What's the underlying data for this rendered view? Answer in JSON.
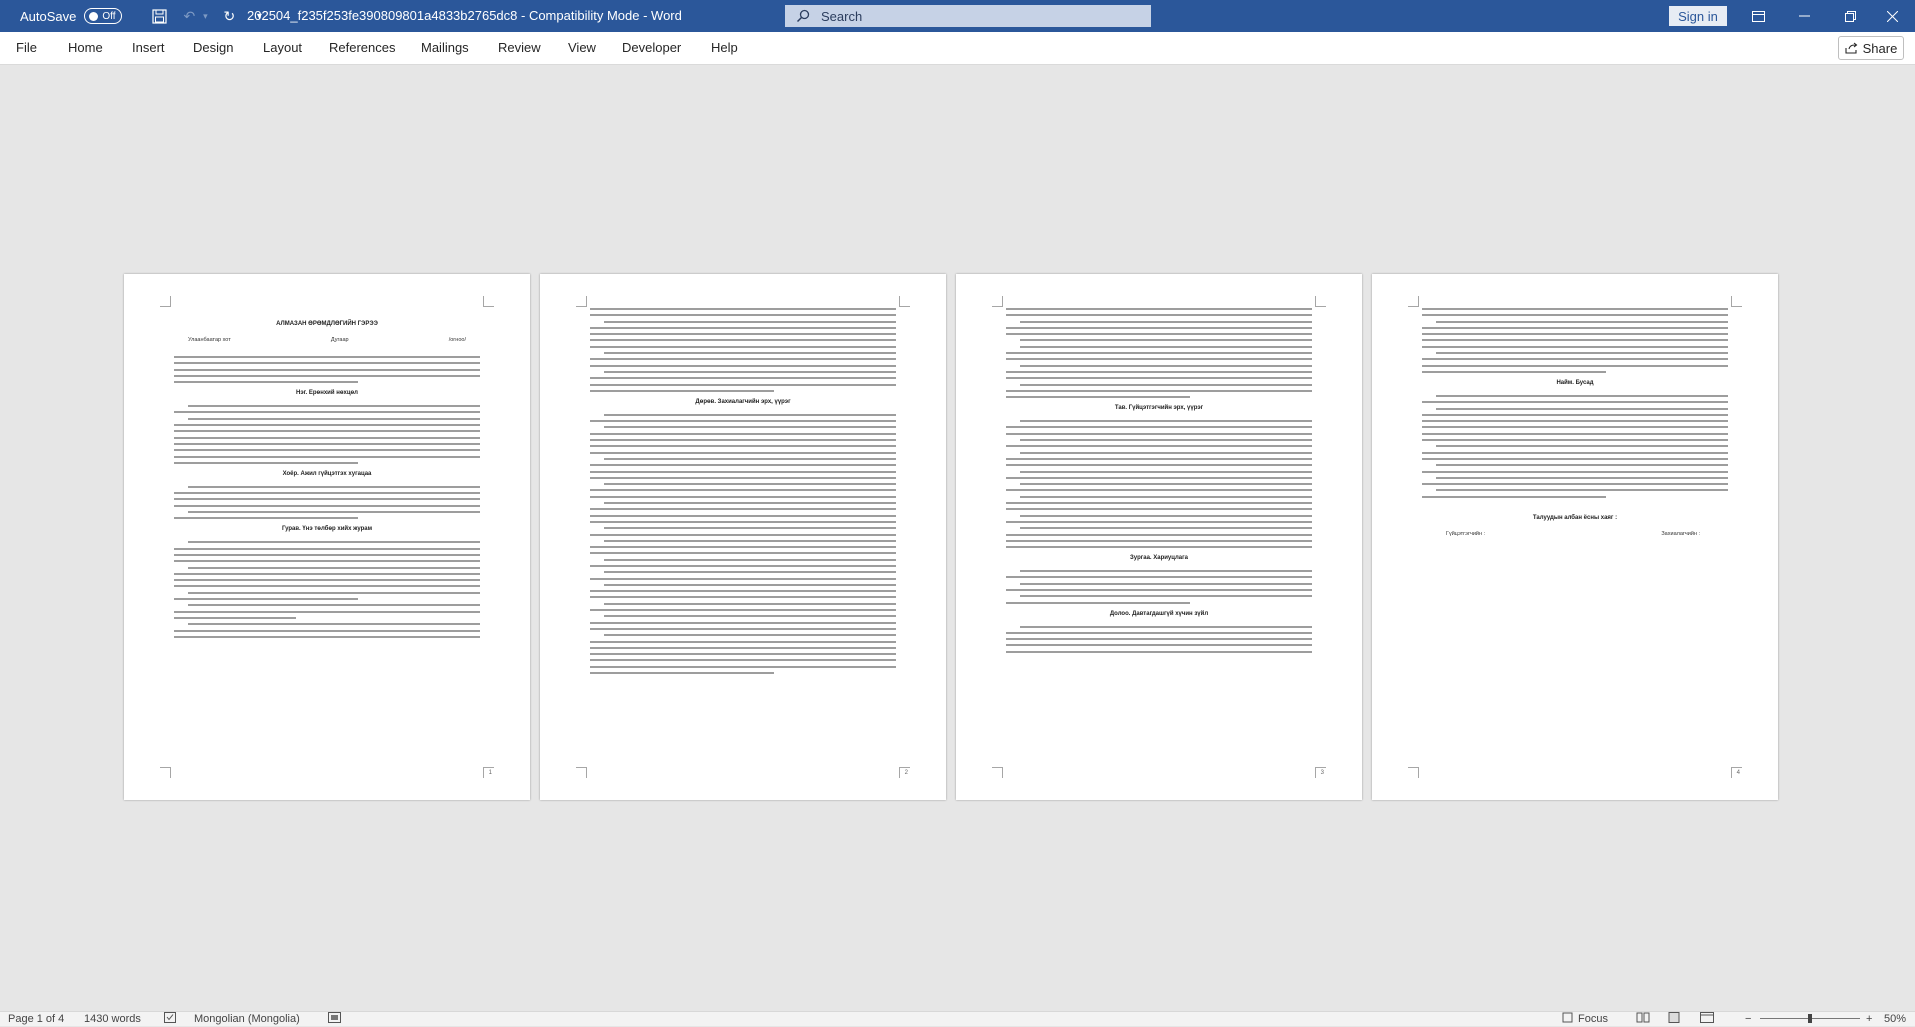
{
  "titlebar": {
    "autosave_label": "AutoSave",
    "autosave_state": "Off",
    "document_title": "202504_f235f253fe390809801a4833b2765dc8  -  Compatibility Mode  -  Word",
    "search_placeholder": "Search",
    "signin_label": "Sign in",
    "icons": [
      "save-icon",
      "undo-icon",
      "redo-icon",
      "customize-qat-icon",
      "ribbon-display-icon",
      "minimize-icon",
      "restore-icon",
      "close-icon"
    ]
  },
  "menu": {
    "tabs": [
      "File",
      "Home",
      "Insert",
      "Design",
      "Layout",
      "References",
      "Mailings",
      "Review",
      "View",
      "Developer",
      "Help"
    ],
    "share_label": "Share"
  },
  "pages": [
    {
      "title": "АЛМАЗАН ӨРӨМДЛӨГИЙН ГЭРЭЭ",
      "place": "Улаанбаатар хот",
      "doc_no": "Дугаар",
      "date": "/огноо/",
      "h1": "Нэг. Ерөнхий нөхцөл",
      "h2": "Хоёр. Ажил гүйцэтгэх хугацаа",
      "h3": "Гурав. Үнэ төлбөр хийх журам",
      "number": "1"
    },
    {
      "h1": "Дөрөв. Захиалагчийн  эрх, үүрэг",
      "number": "2"
    },
    {
      "h1": "Тав. Гүйцэтгэгчийн эрх, үүрэг",
      "h2": "Зургаа. Хариуцлага",
      "h3": "Долоо. Давтагдашгүй хүчин зүйл",
      "number": "3"
    },
    {
      "h1": "Найм. Бусад",
      "h2": "Талуудын  албан ёсны хаяг :",
      "sig_left": "Гүйцэтгэгчийн :",
      "sig_right": "Захиалагчийн :",
      "number": "4"
    }
  ],
  "status": {
    "page": "Page 1 of 4",
    "words": "1430 words",
    "language": "Mongolian (Mongolia)",
    "focus": "Focus",
    "zoom": "50%",
    "zoom_fraction": 0.5
  }
}
